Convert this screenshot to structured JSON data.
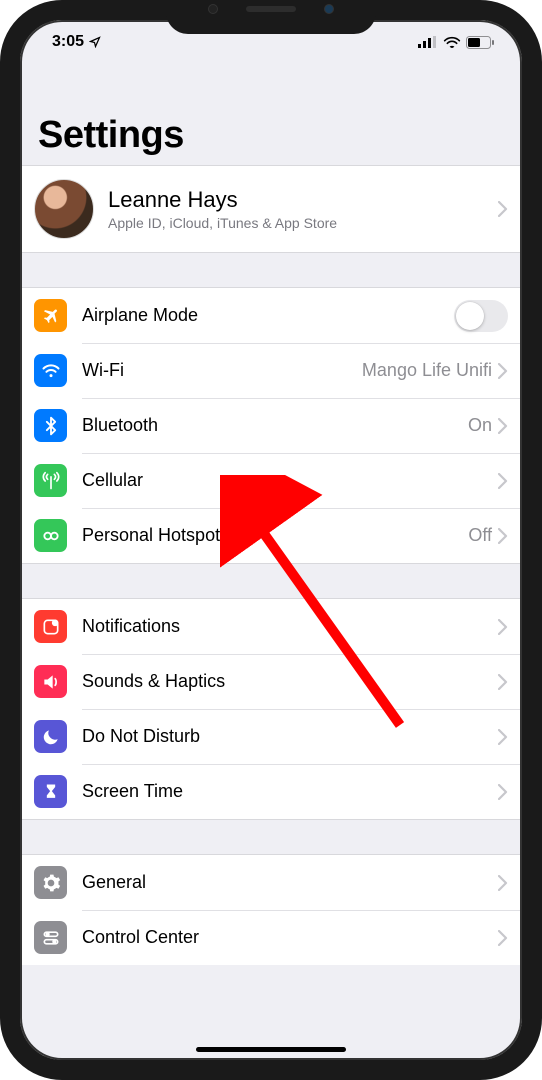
{
  "status": {
    "time": "3:05"
  },
  "title": "Settings",
  "profile": {
    "name": "Leanne Hays",
    "subtitle": "Apple ID, iCloud, iTunes & App Store"
  },
  "group1": {
    "airplane": {
      "label": "Airplane Mode",
      "color": "#ff9500"
    },
    "wifi": {
      "label": "Wi-Fi",
      "value": "Mango Life Unifi",
      "color": "#007aff"
    },
    "bluetooth": {
      "label": "Bluetooth",
      "value": "On",
      "color": "#007aff"
    },
    "cellular": {
      "label": "Cellular",
      "color": "#34c759"
    },
    "hotspot": {
      "label": "Personal Hotspot",
      "value": "Off",
      "color": "#34c759"
    }
  },
  "group2": {
    "notifications": {
      "label": "Notifications",
      "color": "#ff3b30"
    },
    "sounds": {
      "label": "Sounds & Haptics",
      "color": "#ff2d55"
    },
    "dnd": {
      "label": "Do Not Disturb",
      "color": "#5856d6"
    },
    "screentime": {
      "label": "Screen Time",
      "color": "#5856d6"
    }
  },
  "group3": {
    "general": {
      "label": "General",
      "color": "#8e8e93"
    },
    "controlcenter": {
      "label": "Control Center",
      "color": "#8e8e93"
    }
  }
}
